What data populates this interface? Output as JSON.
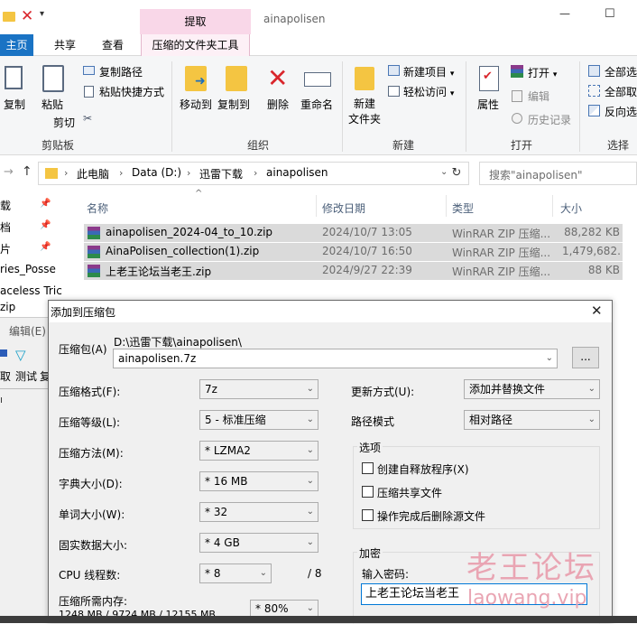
{
  "titlebar": {
    "extract_tab": "提取",
    "folder_name": "ainapolisen",
    "minimize": "—",
    "maximize": "☐"
  },
  "ribbon_tabs": [
    "主页",
    "共享",
    "查看",
    "压缩的文件夹工具"
  ],
  "ribbon": {
    "copy": "复制",
    "paste": "粘贴",
    "copy_path": "复制路径",
    "paste_shortcut": "粘贴快捷方式",
    "cut": "剪切",
    "group_clipboard": "剪贴板",
    "move_to": "移动到",
    "copy_to": "复制到",
    "delete": "删除",
    "rename": "重命名",
    "group_organize": "组织",
    "new_folder_line1": "新建",
    "new_folder_line2": "文件夹",
    "new_item": "新建项目",
    "easy_access": "轻松访问",
    "group_new": "新建",
    "properties": "属性",
    "open": "打开",
    "edit": "编辑",
    "history": "历史记录",
    "group_open": "打开",
    "select_all": "全部选",
    "select_none": "全部取",
    "invert_selection": "反向选",
    "group_select": "选择"
  },
  "address": {
    "path": [
      "此电脑",
      "Data (D:)",
      "迅雷下载",
      "ainapolisen"
    ],
    "search_placeholder": "搜索\"ainapolisen\""
  },
  "columns": {
    "name": "名称",
    "date": "修改日期",
    "type": "类型",
    "size": "大小"
  },
  "files": [
    {
      "name": "ainapolisen_2024-04_to_10.zip",
      "date": "2024/10/7 13:05",
      "type": "WinRAR ZIP 压缩...",
      "size": "88,282 KB"
    },
    {
      "name": "AinaPolisen_collection(1).zip",
      "date": "2024/10/7 16:50",
      "type": "WinRAR ZIP 压缩...",
      "size": "1,479,682..."
    },
    {
      "name": "上老王论坛当老王.zip",
      "date": "2024/9/27 22:39",
      "type": "WinRAR ZIP 压缩...",
      "size": "88 KB"
    }
  ],
  "sidebar_fragments": [
    "载",
    "档",
    "片",
    "ries_Posse",
    "aceless Tric",
    "zip"
  ],
  "behind_window": {
    "edit_label": "编辑(E)",
    "extract_label": "取",
    "test_label": "测试",
    "extra_label": "复"
  },
  "dialog": {
    "title": "添加到压缩包",
    "close": "✕",
    "archive_label": "压缩包(A)",
    "archive_path": "D:\\迅雷下载\\ainapolisen\\",
    "archive_name": "ainapolisen.7z",
    "browse": "...",
    "format_label": "压缩格式(F):",
    "format_value": "7z",
    "level_label": "压缩等级(L):",
    "level_value": "5 - 标准压缩",
    "method_label": "压缩方法(M):",
    "method_value": "*  LZMA2",
    "dict_label": "字典大小(D):",
    "dict_value": "*  16 MB",
    "word_label": "单词大小(W):",
    "word_value": "*  32",
    "solid_label": "固实数据大小:",
    "solid_value": "*  4 GB",
    "threads_label": "CPU 线程数:",
    "threads_value": "*  8",
    "threads_total": "/ 8",
    "memory_label": "压缩所需内存:",
    "memory_value": "1248 MB / 9724 MB / 12155 MB",
    "memory_percent": "*  80%",
    "update_label": "更新方式(U):",
    "update_value": "添加并替换文件",
    "pathmode_label": "路径模式",
    "pathmode_value": "相对路径",
    "options_title": "选项",
    "opt_sfx": "创建自释放程序(X)",
    "opt_shared": "压缩共享文件",
    "opt_delete": "操作完成后删除源文件",
    "encrypt_title": "加密",
    "password_label": "输入密码:",
    "password_value": "上老王论坛当老王"
  },
  "watermark": {
    "title": "老王论坛",
    "url": "laowang.vip"
  },
  "colors": {
    "extract_tab_bg": "#f9d7e8",
    "selected_row": "#dadada",
    "watermark": "#e9a5b3",
    "delete_red": "#d9262c",
    "folder_yellow": "#f4c542"
  }
}
